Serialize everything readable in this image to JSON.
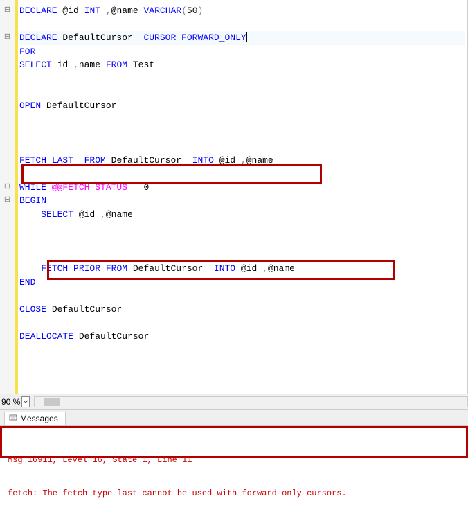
{
  "code": {
    "lines": [
      {
        "tokens": [
          {
            "t": "DECLARE ",
            "c": "kw"
          },
          {
            "t": "@id ",
            "c": ""
          },
          {
            "t": "INT ",
            "c": "ty"
          },
          {
            "t": ",",
            "c": "gray"
          },
          {
            "t": "@name ",
            "c": ""
          },
          {
            "t": "VARCHAR",
            "c": "ty"
          },
          {
            "t": "(",
            "c": "gray"
          },
          {
            "t": "50",
            "c": ""
          },
          {
            "t": ")",
            "c": "gray"
          }
        ]
      },
      {
        "tokens": []
      },
      {
        "tokens": [
          {
            "t": "DECLARE ",
            "c": "kw"
          },
          {
            "t": "DefaultCursor  ",
            "c": ""
          },
          {
            "t": "CURSOR FORWARD_ONLY",
            "c": "kw"
          }
        ],
        "cursor": true,
        "hl": true
      },
      {
        "tokens": [
          {
            "t": "FOR",
            "c": "kw"
          }
        ]
      },
      {
        "tokens": [
          {
            "t": "SELECT ",
            "c": "kw"
          },
          {
            "t": "id ",
            "c": ""
          },
          {
            "t": ",",
            "c": "gray"
          },
          {
            "t": "name ",
            "c": ""
          },
          {
            "t": "FROM ",
            "c": "kw"
          },
          {
            "t": "Test",
            "c": ""
          }
        ]
      },
      {
        "tokens": []
      },
      {
        "tokens": []
      },
      {
        "tokens": [
          {
            "t": "OPEN ",
            "c": "kw"
          },
          {
            "t": "DefaultCursor",
            "c": ""
          }
        ]
      },
      {
        "tokens": []
      },
      {
        "tokens": []
      },
      {
        "tokens": []
      },
      {
        "tokens": [
          {
            "t": "FETCH ",
            "c": "kw"
          },
          {
            "t": "LAST  ",
            "c": "kw"
          },
          {
            "t": "FROM ",
            "c": "kw"
          },
          {
            "t": "DefaultCursor  ",
            "c": ""
          },
          {
            "t": "INTO ",
            "c": "kw"
          },
          {
            "t": "@id ",
            "c": ""
          },
          {
            "t": ",",
            "c": "gray"
          },
          {
            "t": "@name",
            "c": ""
          }
        ]
      },
      {
        "tokens": []
      },
      {
        "tokens": [
          {
            "t": "WHILE ",
            "c": "kw"
          },
          {
            "t": "@@FETCH_STATUS",
            "c": "fn"
          },
          {
            "t": " = ",
            "c": "gray"
          },
          {
            "t": "0",
            "c": ""
          }
        ]
      },
      {
        "tokens": [
          {
            "t": "BEGIN",
            "c": "kw"
          }
        ]
      },
      {
        "tokens": [
          {
            "t": "    ",
            "c": ""
          },
          {
            "t": "SELECT ",
            "c": "kw"
          },
          {
            "t": "@id ",
            "c": ""
          },
          {
            "t": ",",
            "c": "gray"
          },
          {
            "t": "@name",
            "c": ""
          }
        ]
      },
      {
        "tokens": []
      },
      {
        "tokens": []
      },
      {
        "tokens": []
      },
      {
        "tokens": [
          {
            "t": "    ",
            "c": ""
          },
          {
            "t": "FETCH ",
            "c": "kw"
          },
          {
            "t": "PRIOR ",
            "c": "kw"
          },
          {
            "t": "FROM ",
            "c": "kw"
          },
          {
            "t": "DefaultCursor  ",
            "c": ""
          },
          {
            "t": "INTO ",
            "c": "kw"
          },
          {
            "t": "@id ",
            "c": ""
          },
          {
            "t": ",",
            "c": "gray"
          },
          {
            "t": "@name",
            "c": ""
          }
        ]
      },
      {
        "tokens": [
          {
            "t": "END",
            "c": "kw"
          }
        ]
      },
      {
        "tokens": []
      },
      {
        "tokens": [
          {
            "t": "CLOSE ",
            "c": "kw"
          },
          {
            "t": "DefaultCursor",
            "c": ""
          }
        ]
      },
      {
        "tokens": []
      },
      {
        "tokens": [
          {
            "t": "DEALLOCATE ",
            "c": "kw"
          },
          {
            "t": "DefaultCursor",
            "c": ""
          }
        ]
      },
      {
        "tokens": []
      },
      {
        "tokens": []
      },
      {
        "tokens": []
      }
    ],
    "fold_markers": {
      "0": "-",
      "2": "-",
      "13": "-",
      "14": "-"
    }
  },
  "zoom": {
    "label": "90 %"
  },
  "tabs": {
    "messages": "Messages"
  },
  "messages": {
    "line1": "Msg 16911, Level 16, State 1, Line 11",
    "line2": "fetch: The fetch type last cannot be used with forward only cursors."
  }
}
